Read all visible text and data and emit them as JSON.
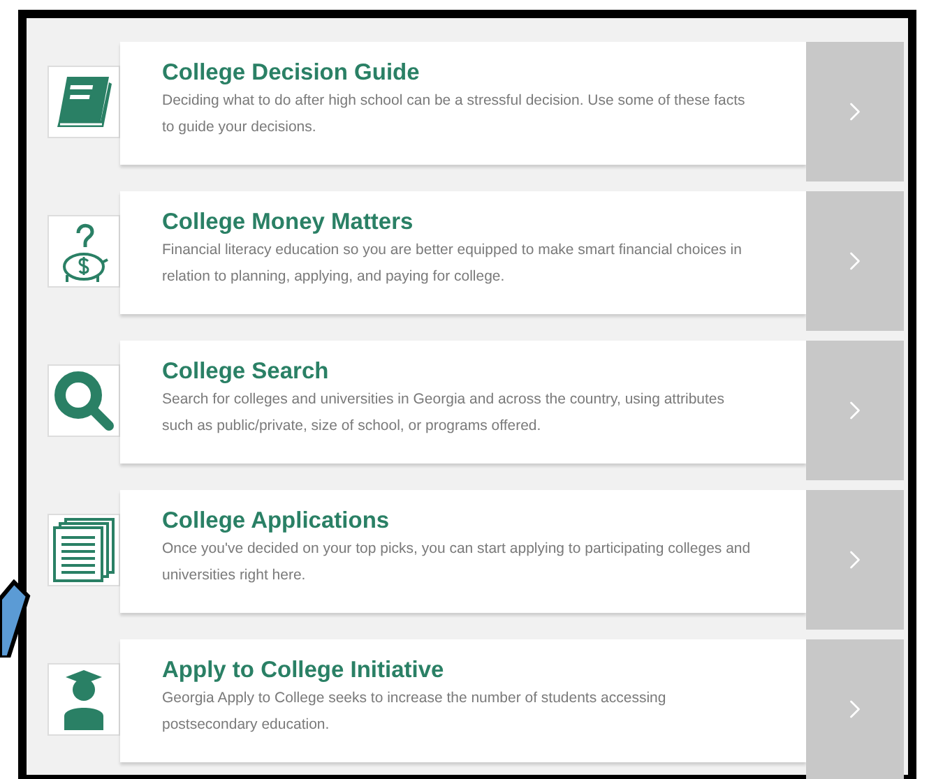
{
  "items": [
    {
      "kind": "book",
      "title": "College Decision Guide",
      "description": "Deciding what to do after high school can be a stressful decision. Use some of these facts to guide your decisions."
    },
    {
      "kind": "piggy-bank",
      "title": "College Money Matters",
      "description": "Financial literacy education so you are better equipped to make smart financial choices in relation to planning, applying, and paying for college."
    },
    {
      "kind": "magnifier",
      "title": "College Search",
      "description": "Search for colleges and universities in Georgia and across the country, using attributes such as public/private, size of school, or programs offered."
    },
    {
      "kind": "documents",
      "title": "College Applications",
      "description": "Once you've decided on your top picks, you can start applying to participating colleges and universities right here."
    },
    {
      "kind": "graduate",
      "title": "Apply to College Initiative",
      "description": "Georgia Apply to College seeks to increase the number of students accessing postsecondary education."
    }
  ]
}
